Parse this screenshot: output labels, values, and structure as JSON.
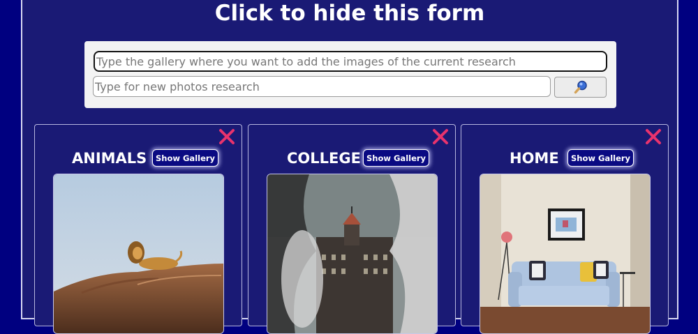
{
  "header": {
    "title": "Click to hide this form"
  },
  "form": {
    "gallery_placeholder": "Type the gallery where you want to add the images of the current research",
    "search_placeholder": "Type for new photos research",
    "search_button_icon": "magnifier-icon"
  },
  "cards": [
    {
      "title": "ANIMALS",
      "button_label": "Show Gallery",
      "close_icon": "close-icon"
    },
    {
      "title": "COLLEGE",
      "button_label": "Show Gallery",
      "close_icon": "close-icon"
    },
    {
      "title": "HOME",
      "button_label": "Show Gallery",
      "close_icon": "close-icon"
    }
  ],
  "colors": {
    "background": "#000080",
    "panel": "#1a1a75",
    "close_icon": "#e8336d",
    "button_bg": "#0a0a82"
  }
}
